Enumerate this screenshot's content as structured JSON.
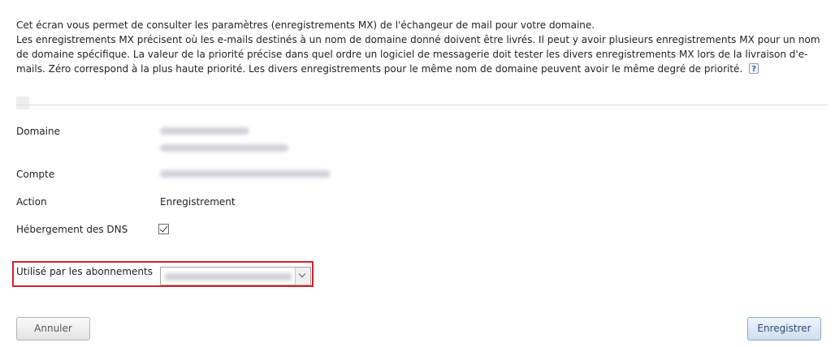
{
  "intro": {
    "line1": "Cet écran vous permet de consulter les paramètres (enregistrements MX) de l'échangeur de mail pour votre domaine.",
    "line2": "Les enregistrements MX précisent où les e-mails destinés à un nom de domaine donné doivent être livrés.  Il peut y avoir plusieurs enregistrements MX pour un nom de domaine spécifique. La valeur de la priorité précise dans quel ordre un logiciel de messagerie doit tester les divers enregistrements MX lors de la livraison d'e-mails. Zéro correspond à la plus haute priorité. Les divers enregistrements pour le même nom de domaine peuvent avoir le même degré de priorité.",
    "help_icon": "help-icon"
  },
  "form": {
    "domain_label": "Domaine",
    "account_label": "Compte",
    "action_label": "Action",
    "action_value": "Enregistrement",
    "dns_label": "Hébergement des DNS",
    "dns_checked": true,
    "subscriptions_label": "Utilisé par les abonnements"
  },
  "buttons": {
    "cancel": "Annuler",
    "save": "Enregistrer"
  },
  "colors": {
    "highlight": "#d3222a",
    "save_button_text": "#2c4a73"
  }
}
